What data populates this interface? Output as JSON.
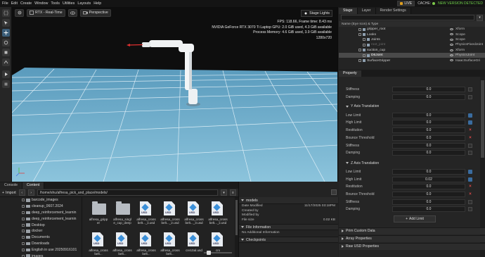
{
  "menu": [
    "File",
    "Edit",
    "Create",
    "Window",
    "Tools",
    "Utilities",
    "Layouts",
    "Help"
  ],
  "status": {
    "live": "LIVE",
    "cache": "CACHE:",
    "new_version": "NEW VERSION DETECTED"
  },
  "viewport": {
    "renderer": "RTX - Real-Time",
    "camera": "Perspective",
    "stage_lights": "Stage Lights",
    "stats": [
      "FPS: 118.66, Frame time: 8.43 ms",
      "NVIDIA GeForce RTX 3070 Ti Laptop GPU: 2.0 GiB used, 4.3 GiB available",
      "Process Memory: 4.6 GiB used, 3.9 GiB available",
      "1280x720"
    ]
  },
  "bottom_tabs": [
    "Console",
    "Content"
  ],
  "content": {
    "import_label": "Import",
    "path": "/home/shu/alfresa_pick_and_place/models/",
    "tree": [
      "barcode_images",
      "cleanup_0607.2024",
      "deep_reinforcement_learnin",
      "deep_reinforcement_learnin",
      "Desktop",
      "docker",
      "Documents",
      "Downloads",
      "English in use 20250916101",
      "images",
      "isaac_sim"
    ],
    "items": [
      {
        "label": "alfresa_gripp er",
        "kind": "folder"
      },
      {
        "label": "alfresa_singl e_cup_deep",
        "kind": "folder"
      },
      {
        "label": "alfresa_cross belt..._ii.usd",
        "kind": "usd"
      },
      {
        "label": "alfresa_cross belt..._2.usd",
        "kind": "usd"
      },
      {
        "label": "alfresa_cross belt..._3.usd",
        "kind": "usd"
      },
      {
        "label": "alfresa_cross belt..._ii.usd",
        "kind": "usd"
      },
      {
        "label": "alfresa_cross belt...",
        "kind": "usd"
      },
      {
        "label": "alfresa_cross belt...",
        "kind": "usd"
      },
      {
        "label": "alfresa_cross belt...",
        "kind": "usd"
      },
      {
        "label": "alfresa_cross belt...",
        "kind": "usd"
      },
      {
        "label": "cre10al.usd",
        "kind": "usd"
      },
      {
        "label": "crx",
        "kind": "usd"
      }
    ]
  },
  "details": {
    "models_title": "models",
    "fields": [
      {
        "k": "Date Modified",
        "v": "11/17/2025 03:18PM"
      },
      {
        "k": "Created by",
        "v": ""
      },
      {
        "k": "Modified by",
        "v": ""
      },
      {
        "k": "File size",
        "v": "0.02 KB"
      }
    ],
    "file_info_title": "File Information",
    "no_info": "No Additional Information",
    "checkpoints_title": "Checkpoints"
  },
  "stage": {
    "tabs": [
      "Stage",
      "Layer",
      "Render Settings"
    ],
    "header": "Name (Eye Icon) & Type",
    "rows": [
      {
        "name": "gripper_root",
        "type": "Xform",
        "indent": 28,
        "state": ""
      },
      {
        "name": "Looks",
        "type": "Scope",
        "indent": 28,
        "state": ""
      },
      {
        "name": "Joints",
        "type": "Scope",
        "indent": 34,
        "state": ""
      },
      {
        "name": "root_joint",
        "type": "PhysicsFixedJoint",
        "indent": 34,
        "state": "dim"
      },
      {
        "name": "suction_cup",
        "type": "Xform",
        "indent": 28,
        "state": ""
      },
      {
        "name": "D6Joint",
        "type": "PhysicsJoint",
        "indent": 34,
        "state": "sel"
      },
      {
        "name": "SurfaceGripper",
        "type": "IsaacSurfaceGri",
        "indent": 28,
        "state": ""
      }
    ]
  },
  "property": {
    "tab": "Property",
    "rows_top": [
      {
        "label": "Stiffness",
        "value": "0.0"
      },
      {
        "label": "Damping",
        "value": "0.0"
      }
    ],
    "y_title": "Y Axis Translation",
    "y_rows": [
      {
        "label": "Low Limit",
        "value": "0.0",
        "ctl": "blue"
      },
      {
        "label": "High Limit",
        "value": "0.0",
        "ctl": "blue"
      },
      {
        "label": "Restitution",
        "value": "0.0",
        "ctl": "red"
      },
      {
        "label": "Bounce Threshold",
        "value": "0.0",
        "ctl": "red"
      },
      {
        "label": "Stiffness",
        "value": "0.0",
        "ctl": ""
      },
      {
        "label": "Damping",
        "value": "0.0",
        "ctl": ""
      }
    ],
    "z_title": "Z Axis Translation",
    "z_rows": [
      {
        "label": "Low Limit",
        "value": "0.0",
        "ctl": "blue"
      },
      {
        "label": "High Limit",
        "value": "0.02",
        "ctl": "blue"
      },
      {
        "label": "Restitution",
        "value": "0.0",
        "ctl": "red"
      },
      {
        "label": "Bounce Threshold",
        "value": "0.0",
        "ctl": "red"
      },
      {
        "label": "Stiffness",
        "value": "0.0",
        "ctl": ""
      },
      {
        "label": "Damping",
        "value": "0.0",
        "ctl": ""
      }
    ],
    "add_limit": "Add Limit",
    "sections": [
      "Prim Custom Data",
      "Array Properties",
      "Raw USD Properties"
    ]
  }
}
